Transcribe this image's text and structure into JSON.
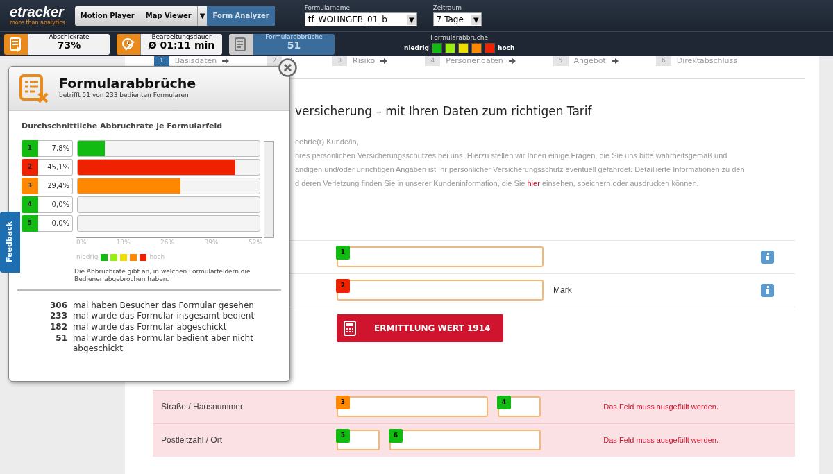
{
  "header": {
    "logo": "etracker",
    "tagline": "more than analytics",
    "tabs": [
      {
        "label": "Motion Player",
        "kind": "tab",
        "selected": false
      },
      {
        "label": "Map Viewer",
        "kind": "tab",
        "selected": false
      },
      {
        "label": "▼",
        "kind": "toggle",
        "selected": false
      },
      {
        "label": "Form Analyzer",
        "kind": "tab",
        "selected": true
      }
    ],
    "form_name": {
      "label": "Formularname",
      "value": "tf_WOHNGEB_01_b",
      "arrow": "▼"
    },
    "period": {
      "label": "Zeitraum",
      "value": "7 Tage",
      "arrow": "▼"
    },
    "metrics": [
      {
        "label": "Abschickrate",
        "value": "73%",
        "kind": "send",
        "selected": false
      },
      {
        "label": "Bearbeitungsdauer",
        "value": "Ø 01:11 min",
        "kind": "time",
        "selected": false
      },
      {
        "label": "Formularabbrüche",
        "value": "51",
        "kind": "abort",
        "selected": true
      }
    ],
    "legend": {
      "title": "Formularabbrüche",
      "low": "niedrig",
      "high": "hoch",
      "colors": [
        {
          "color": "#11bb11"
        },
        {
          "color": "#99ee11"
        },
        {
          "color": "#eedd00"
        },
        {
          "color": "#ff8800"
        },
        {
          "color": "#ee2200"
        }
      ]
    }
  },
  "steps": [
    {
      "number": "1",
      "label": "Basisdaten",
      "selected": true
    },
    {
      "number": "2",
      "selected": false
    },
    {
      "number": "3",
      "label": "Risiko",
      "selected": false
    },
    {
      "number": "4",
      "label": "Personendaten",
      "selected": false
    },
    {
      "number": "5",
      "label": "Angebot",
      "selected": false
    },
    {
      "number": "6",
      "label": "Direktabschluss",
      "selected": false
    }
  ],
  "page": {
    "heading": "versicherung – mit Ihren Daten zum richtigen Tarif",
    "lines": [
      "eehrte(r) Kunde/in,",
      "hres persönlichen Versicherungsschutzes bei uns. Hierzu stellen wir Ihnen einige Fragen, die Sie uns bitte wahrheitsgemäß und",
      "ändigen und/oder unrichtigen Angaben ist Ihr persönlicher Versicherungsschutz eventuell gefährdet. Detaillierte Informationen zu den"
    ],
    "last_line": {
      "before": "d deren Verletzung finden Sie in unserer Kundeninformation, die Sie",
      "link": "hier",
      "after": "einsehen, speichern oder ausdrucken können."
    },
    "rows": [
      {
        "kind": "fields",
        "fields": [
          {
            "number": "1",
            "color": "#11bb11",
            "kind": "long"
          }
        ],
        "info": true
      },
      {
        "kind": "fields",
        "fields": [
          {
            "number": "2",
            "color": "#ee2200",
            "kind": "long"
          }
        ],
        "suffix": "Mark",
        "info": true
      },
      {
        "kind": "button",
        "button": "ERMITTLUNG WERT 1914"
      },
      {
        "kind": "error",
        "label": "Straße / Hausnummer",
        "fields": [
          {
            "number": "3",
            "color": "#ff8800",
            "kind": "medium"
          },
          {
            "number": "4",
            "color": "#11bb11",
            "kind": "short"
          }
        ],
        "error": "Das Feld muss ausgefüllt werden."
      },
      {
        "kind": "error",
        "label": "Postleitzahl / Ort",
        "fields": [
          {
            "number": "5",
            "color": "#11bb11",
            "kind": "short"
          },
          {
            "number": "6",
            "color": "#11bb11",
            "kind": "medium"
          }
        ],
        "error": "Das Feld muss ausgefüllt werden."
      }
    ]
  },
  "popup": {
    "title": "Formularabbrüche",
    "subtitle": "betrifft 51 von 233 bedienten Formularen",
    "section_title": "Durchschnittliche Abbruchrate je Formularfeld",
    "rows": [
      {
        "number": "1",
        "rate": "7,8%",
        "color": "#11bb11",
        "level": 0.15
      },
      {
        "number": "2",
        "rate": "45,1%",
        "color": "#ee2200",
        "level": 0.867
      },
      {
        "number": "3",
        "rate": "29,4%",
        "color": "#ff8800",
        "level": 0.565
      },
      {
        "number": "4",
        "rate": "0,0%",
        "color": "#11bb11",
        "level": 0
      },
      {
        "number": "5",
        "rate": "0,0%",
        "color": "#11bb11",
        "level": 0
      }
    ],
    "axis_ticks": [
      "0%",
      "13%",
      "26%",
      "39%",
      "52%"
    ],
    "legend": {
      "low": "niedrig",
      "high": "hoch",
      "colors": [
        {
          "color": "#11bb11"
        },
        {
          "color": "#99ee11"
        },
        {
          "color": "#eedd00"
        },
        {
          "color": "#ff8800"
        },
        {
          "color": "#ee2200"
        }
      ]
    },
    "note": "Die Abbruchrate gibt an, in welchen Formularfeldern die Bediener abgebrochen haben.",
    "stats": [
      {
        "count": "306",
        "text": "mal haben Besucher das Formular gesehen"
      },
      {
        "count": "233",
        "text": "mal wurde das Formular insgesamt bedient"
      },
      {
        "count": "182",
        "text": "mal wurde das Formular abgeschickt"
      },
      {
        "count": "51",
        "text": "mal wurde das Formular bedient aber nicht abgeschickt"
      }
    ]
  },
  "feedback": "Feedback"
}
